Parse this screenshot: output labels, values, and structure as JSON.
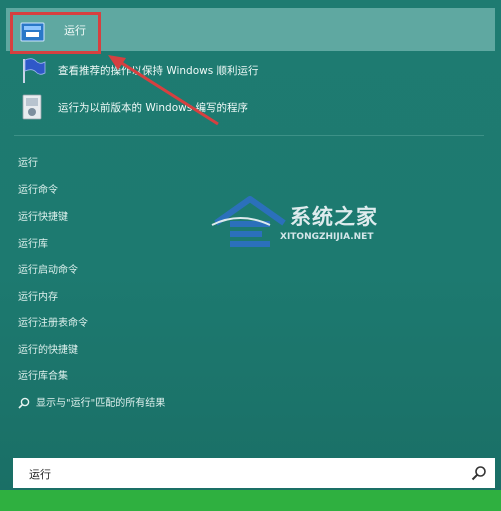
{
  "top_result": {
    "label": "运行",
    "icon": "run-dialog-icon"
  },
  "apps": [
    {
      "label": "查看推荐的操作以保持 Windows 顺利运行",
      "icon": "action-center-flag-icon"
    },
    {
      "label": "运行为以前版本的 Windows 编写的程序",
      "icon": "compatibility-troubleshooter-icon"
    }
  ],
  "suggestions": [
    "运行",
    "运行命令",
    "运行快捷键",
    "运行库",
    "运行启动命令",
    "运行内存",
    "运行注册表命令",
    "运行的快捷键",
    "运行库合集"
  ],
  "search_all": {
    "label": "显示与\"运行\"匹配的所有结果",
    "icon": "search-icon"
  },
  "search_box": {
    "value": "运行",
    "icon": "search-icon"
  },
  "watermark": {
    "title": "系统之家",
    "subtitle": "XITONGZHIJIA.NET"
  },
  "colors": {
    "background": "#1f7a70",
    "selected": "#5fa8a1",
    "highlight": "#d64040",
    "taskbar": "#2fb040"
  }
}
